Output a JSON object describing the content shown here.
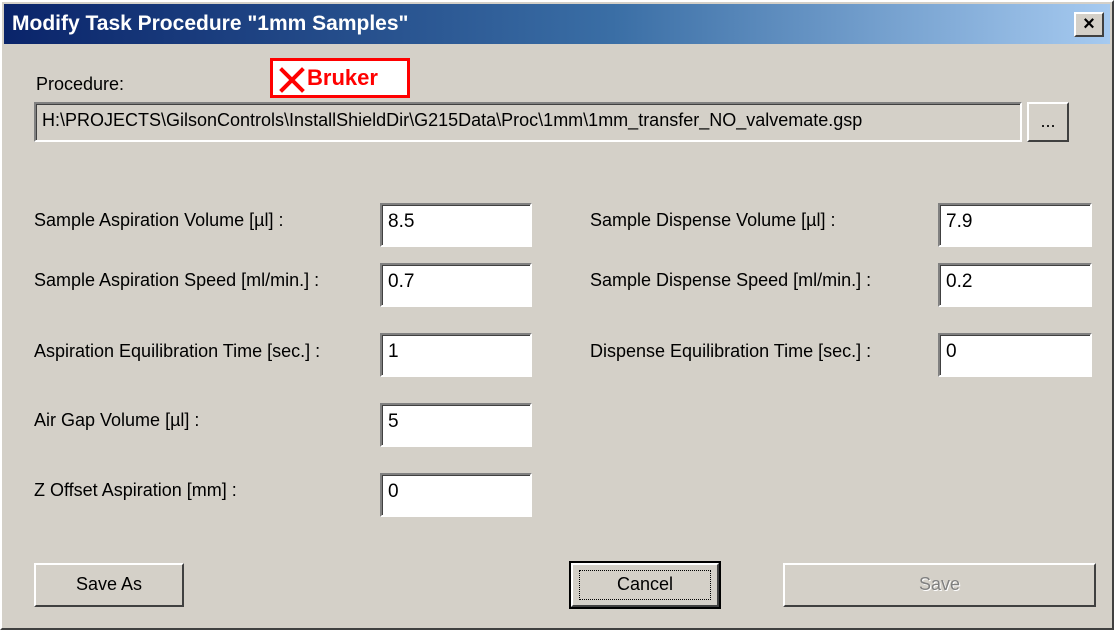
{
  "window": {
    "title": "Modify Task Procedure \"1mm Samples\"",
    "close_glyph": "×"
  },
  "procedure": {
    "label": "Procedure:",
    "path": "H:\\PROJECTS\\GilsonControls\\InstallShieldDir\\G215Data\\Proc\\1mm\\1mm_transfer_NO_valvemate.gsp",
    "browse_label": "..."
  },
  "logo": {
    "text": "Bruker",
    "icon": "x-mark-icon",
    "color": "#ff0000"
  },
  "left_fields": [
    {
      "label": "Sample Aspiration Volume [µl] :",
      "value": "8.5"
    },
    {
      "label": "Sample Aspiration Speed [ml/min.] :",
      "value": "0.7"
    },
    {
      "label": "Aspiration Equilibration Time [sec.] :",
      "value": "1"
    },
    {
      "label": "Air Gap Volume [µl] :",
      "value": "5"
    },
    {
      "label": "Z Offset Aspiration [mm] :",
      "value": "0"
    }
  ],
  "right_fields": [
    {
      "label": "Sample Dispense Volume [µl] :",
      "value": "7.9"
    },
    {
      "label": "Sample Dispense Speed [ml/min.] :",
      "value": "0.2"
    },
    {
      "label": "Dispense Equilibration Time [sec.] :",
      "value": "0"
    }
  ],
  "buttons": {
    "save_as": "Save As",
    "cancel": "Cancel",
    "save": "Save"
  },
  "colors": {
    "dialog_bg": "#d4d0c8",
    "title_start": "#0a246a",
    "title_end": "#a6caf0",
    "disabled_text": "#808080"
  }
}
